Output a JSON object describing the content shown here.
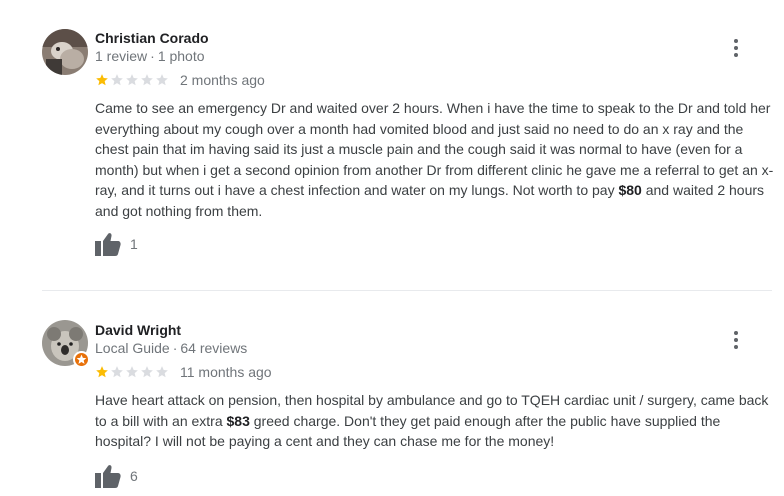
{
  "colors": {
    "star_filled": "#fbbc04",
    "star_empty": "#dadce0",
    "text_primary": "#202124",
    "text_secondary": "#70757a",
    "local_guide_badge": "#e8710a"
  },
  "reviews": [
    {
      "author": "Christian Corado",
      "stats_a": "1 review",
      "stats_b": "1 photo",
      "rating": 1,
      "rating_max": 5,
      "date": "2 months ago",
      "text_a": "Came to see an emergency Dr and waited over 2 hours. When i have the time to speak to the Dr and told her everything about my cough over a month had vomited blood and just said no need to do an x ray and the chest pain that im having said its just a muscle pain and the cough said it was normal to have (even for a month) but when i get a second opinion from another Dr from different clinic he gave me a referral to get an x-ray, and it turns out i have a chest infection and water on my lungs. Not worth to pay ",
      "text_bold": "$80",
      "text_b": " and waited 2 hours and got nothing from them.",
      "likes": "1",
      "icons": {
        "like": "thumbs-up-icon",
        "more": "more-vert-icon"
      }
    },
    {
      "author": "David Wright",
      "stats_a": "Local Guide",
      "stats_b": "64 reviews",
      "rating": 1,
      "rating_max": 5,
      "date": "11 months ago",
      "text_a": "Have heart attack on pension, then hospital by ambulance and go to TQEH cardiac unit / surgery, came back to a bill with an extra ",
      "text_bold": "$83",
      "text_b": " greed charge. Don't they get paid enough after the public have supplied the hospital? I will not be paying a cent and they can chase me for the money!",
      "likes": "6",
      "icons": {
        "like": "thumbs-up-icon",
        "more": "more-vert-icon",
        "badge": "local-guide-star-icon"
      }
    }
  ]
}
